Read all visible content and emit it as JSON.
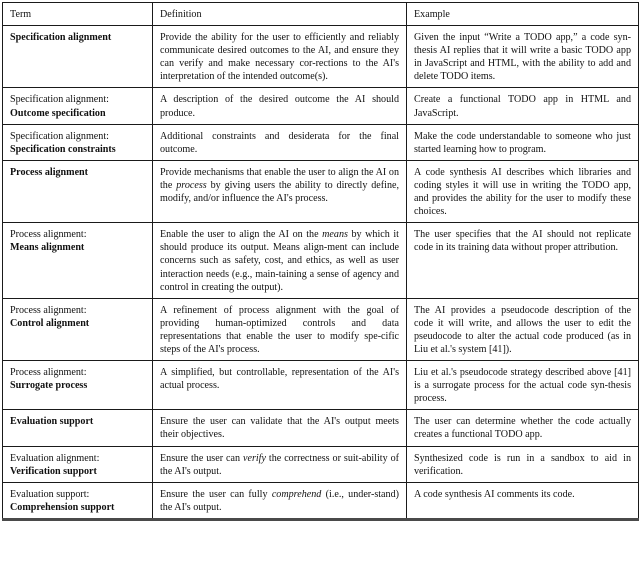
{
  "table": {
    "headers": [
      "Term",
      "Definition",
      "Example"
    ],
    "rows": [
      {
        "term_prefix": "",
        "term_main": "Specification alignment",
        "definition": "Provide the ability for the user to efficiently and reliably communicate desired outcomes to the AI, and ensure they can verify and make necessary cor-rections to the AI's interpretation of the intended outcome(s).",
        "example": "Given the input “Write a TODO app,” a code syn-thesis AI replies that it will write a basic TODO app in JavaScript and HTML, with the ability to add and delete TODO items."
      },
      {
        "term_prefix": "Specification alignment:",
        "term_main": "Outcome specification",
        "definition": "A description of the desired outcome the AI should produce.",
        "example": "Create a functional TODO app in HTML and JavaScript."
      },
      {
        "term_prefix": "Specification alignment:",
        "term_main": "Specification constraints",
        "definition": "Additional constraints and desiderata for the final outcome.",
        "example": "Make the code understandable to someone who just started learning how to program."
      },
      {
        "term_prefix": "",
        "term_main": "Process alignment",
        "definition_parts": [
          "Provide mechanisms that enable the user to align the AI on the ",
          "process",
          " by giving users the ability to directly define, modify, and/or influence the AI's process."
        ],
        "definition": "Provide mechanisms that enable the user to align the AI on the process by giving users the ability to directly define, modify, and/or influence the AI's process.",
        "example": "A code synthesis AI describes which libraries and coding styles it will use in writing the TODO app, and provides the ability for the user to modify these choices."
      },
      {
        "term_prefix": "Process alignment:",
        "term_main": "Means alignment",
        "definition_parts": [
          "Enable the user to align the AI on the ",
          "means",
          " by which it should produce its output. Means align-ment can include concerns such as safety, cost, and ethics, as well as user interaction needs (e.g., main-taining a sense of agency and control in creating the output)."
        ],
        "definition": "Enable the user to align the AI on the means by which it should produce its output. Means alignment can include concerns such as safety, cost, and ethics, as well as user interaction needs (e.g., maintaining a sense of agency and control in creating the output).",
        "example": "The user specifies that the AI should not replicate code in its training data without proper attribution."
      },
      {
        "term_prefix": "Process alignment:",
        "term_main": "Control alignment",
        "definition": "A refinement of process alignment with the goal of providing human-optimized controls and data representations that enable the user to modify spe-cific steps of the AI's process.",
        "example": "The AI provides a pseudocode description of the code it will write, and allows the user to edit the pseudocode to alter the actual code produced (as in Liu et al.'s system [41])."
      },
      {
        "term_prefix": "Process alignment:",
        "term_main": "Surrogate process",
        "definition": "A simplified, but controllable, representation of the AI's actual process.",
        "example": "Liu et al.'s pseudocode strategy described above [41] is a surrogate process for the actual code syn-thesis process."
      },
      {
        "term_prefix": "",
        "term_main": "Evaluation support",
        "definition": "Ensure the user can validate that the AI's output meets their objectives.",
        "example": "The user can determine whether the code actually creates a functional TODO app."
      },
      {
        "term_prefix": "Evaluation alignment:",
        "term_main": "Verification support",
        "definition_parts": [
          "Ensure the user can ",
          "verify",
          " the correctness or suit-ability of the AI's output."
        ],
        "definition": "Ensure the user can verify the correctness or suitability of the AI's output.",
        "example": "Synthesized code is run in a sandbox to aid in verification."
      },
      {
        "term_prefix": "Evaluation support:",
        "term_main": "Comprehension support",
        "definition_parts": [
          "Ensure the user can fully ",
          "comprehend",
          " (i.e., under-stand) the AI's output."
        ],
        "definition": "Ensure the user can fully comprehend (i.e., understand) the AI's output.",
        "example": "A code synthesis AI comments its code."
      }
    ]
  }
}
